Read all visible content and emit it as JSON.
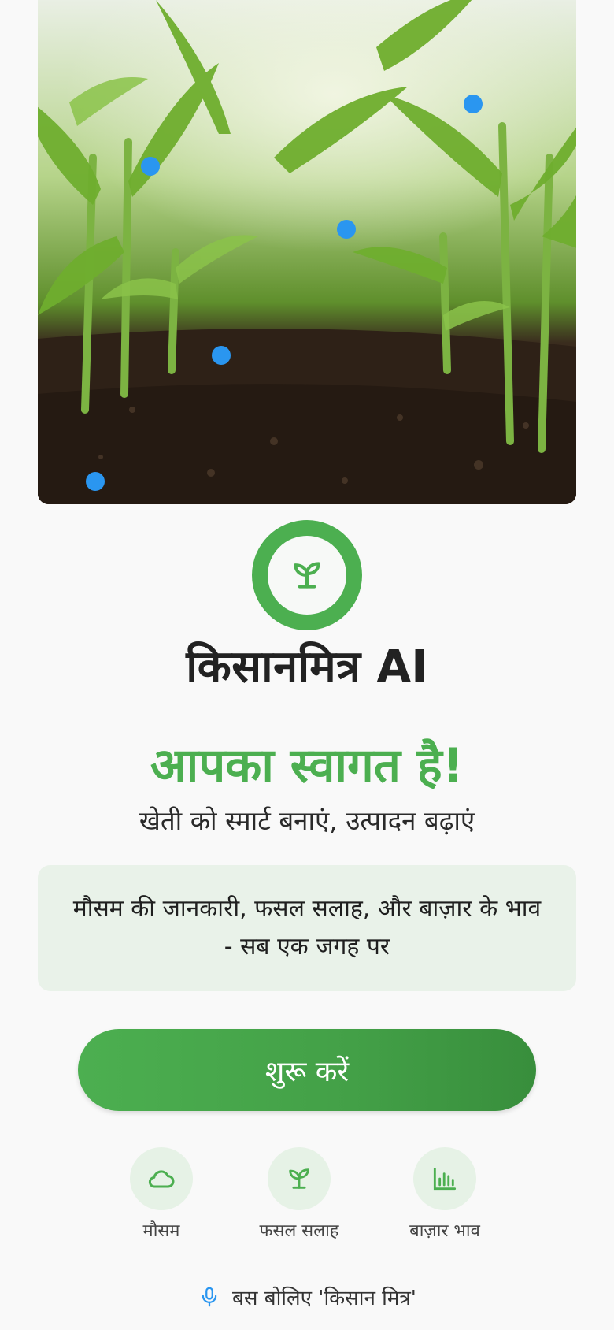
{
  "app": {
    "title": "किसानमित्र AI"
  },
  "hero": {
    "image_alt": "corn-field-photo"
  },
  "welcome": {
    "heading": "आपका स्वागत है!",
    "subtitle": "खेती को स्मार्ट बनाएं, उत्पादन बढ़ाएं"
  },
  "info": {
    "line1": "मौसम की जानकारी, फसल सलाह, और बाज़ार के भाव",
    "line2": "- सब एक जगह पर"
  },
  "start_button": {
    "label": "शुरू करें"
  },
  "features": [
    {
      "label": "मौसम",
      "icon": "cloud-icon"
    },
    {
      "label": "फसल सलाह",
      "icon": "sprout-icon"
    },
    {
      "label": "बाज़ार भाव",
      "icon": "bar-chart-icon"
    }
  ],
  "voice": {
    "text": "बस बोलिए 'किसान मित्र'",
    "icon": "microphone-icon"
  },
  "colors": {
    "primary_green": "#4caf50",
    "dark_green": "#388e3c",
    "light_green_bg": "#e9f2e9",
    "accent_blue": "#2a96f0"
  }
}
